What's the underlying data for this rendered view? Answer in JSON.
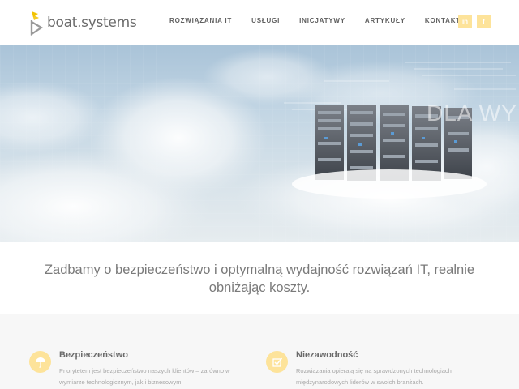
{
  "brand": {
    "name": "boat.systems",
    "accent": "#fde39a",
    "logo_colors": [
      "#f2c200",
      "#9a9a9a"
    ]
  },
  "nav": {
    "items": [
      {
        "label": "ROZWIĄZANIA IT"
      },
      {
        "label": "USŁUGI"
      },
      {
        "label": "INICJATYWY"
      },
      {
        "label": "ARTYKUŁY"
      },
      {
        "label": "KONTAKT"
      }
    ]
  },
  "social": [
    {
      "icon": "linkedin-icon",
      "label": "in"
    },
    {
      "icon": "facebook-icon",
      "label": "f"
    }
  ],
  "hero": {
    "overlay_text": "DLA WYM",
    "bg_color": "#c3d6e4"
  },
  "tagline": "Zadbamy o bezpieczeństwo i optymalną wydajność rozwiązań IT, realnie obniżając koszty.",
  "features": [
    {
      "icon": "umbrella-icon",
      "title": "Bezpieczeństwo",
      "desc": "Priorytetem jest bezpieczeństwo naszych klientów – zarówno w wymiarze technologicznym, jak i biznesowym."
    },
    {
      "icon": "checkbox-icon",
      "title": "Niezawodność",
      "desc": "Rozwiązania opierają się na sprawdzonych technologiach międzynarodowych liderów w swoich branżach."
    }
  ]
}
